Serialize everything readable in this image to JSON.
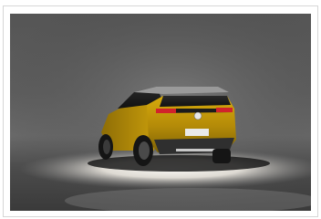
{
  "image": {
    "subject": "car-photo",
    "vehicle_color": "#e2b40e",
    "backdrop_color": "#5a5a5a",
    "floor_light_color": "#f4f1ea"
  }
}
